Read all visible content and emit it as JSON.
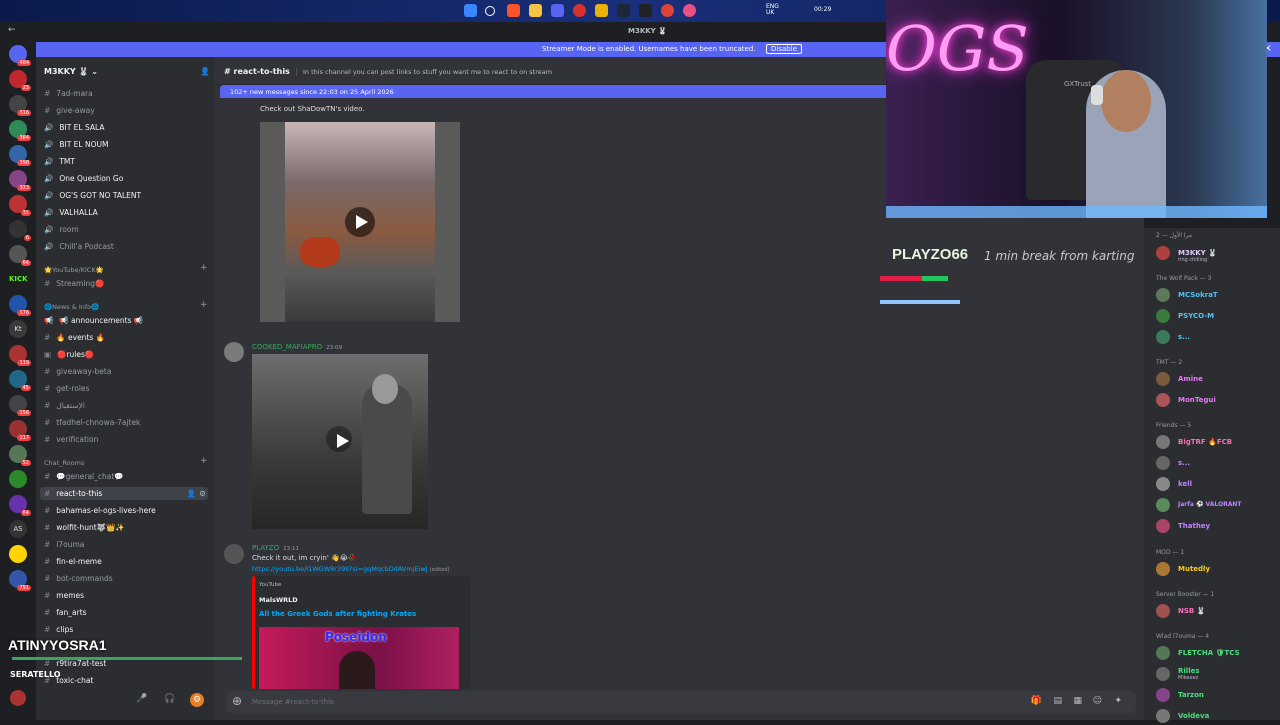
{
  "taskbar": {
    "tray_lang": "ENG",
    "tray_region": "UK",
    "time": "00:29"
  },
  "window": {
    "title": "M3KKY 🐰"
  },
  "streamer_banner": {
    "message": "Streamer Mode is enabled. Usernames have been truncated.",
    "disable_label": "Disable"
  },
  "server_badges": [
    "484",
    "23",
    "316",
    "384",
    "398",
    "323",
    "31",
    "6",
    "64",
    "176",
    "119",
    "45",
    "156",
    "117",
    "52",
    "64",
    "791"
  ],
  "sidebar": {
    "guild_name": "M3KKY 🐰",
    "channels_top": [
      "7ad-mara",
      "give-away",
      "BIT EL SALA",
      "BIT EL NOUM",
      "TMT",
      "One Question Go",
      "OG'S GOT NO TALENT",
      "VALHALLA",
      "room",
      "Chill'a Podcast"
    ],
    "cat_youtube": "🌟YouTube/KICK🌟",
    "streaming": "Streaming🔴",
    "cat_news": "🌐News & Info🌐",
    "news_channels": [
      "📢 announcements 📢",
      "🔥 events 🔥",
      "🔴rules🔴",
      "giveaway-beta",
      "get-roles",
      "الإستقبال",
      "tfadhel-chnowa-7ajtek",
      "verification"
    ],
    "cat_chat": "Chat_Rooms",
    "chat_channels": [
      "💬general_chat💬",
      "react-to-this",
      "bahamas-el-ogs-lives-here",
      "wolfit-hunt🐺👑✨",
      "l7ouma",
      "fin-el-meme",
      "bot-commands",
      "memes",
      "fan_arts",
      "clips",
      "r9tira7at-test",
      "toxic-chat"
    ]
  },
  "channel_header": {
    "name": "react-to-this",
    "topic": "In this channel you can post links to stuff you want me to react to on stream"
  },
  "new_messages_bar": "102+ new messages since 22:03 on 25 April 2026",
  "messages": {
    "shared_text": "Check out ShaDowTN's video.",
    "m2_author": "COOKED_MAFIAPRO",
    "m2_time": "23:09",
    "m3_author": "PLAYZO",
    "m3_time": "23:11",
    "m3_text": "Check it out, im cryin' 👋😭🥀",
    "m3_link": "https://youtu.be/l1WGW8r39lI?si=gqMqcbDdAVmjEiwJ",
    "m3_edited": "(edited)",
    "embed_provider": "YouTube",
    "embed_author": "MalsWRLD",
    "embed_title": "All the Greek Gods after fighting Kratos",
    "embed_thumb_text": "Poseidon"
  },
  "composer": {
    "placeholder": "Message #react-to-this"
  },
  "members": {
    "cat1": "2 — مرا الأول",
    "m1": "M3KKY 🐰",
    "m1_sub": "ring chilling",
    "cat2": "The Wolf Pack — 3",
    "wolf": [
      "MCSokraT",
      "PSYCO-M",
      "s..."
    ],
    "cat3": "TMT — 2",
    "tmt": [
      "Amine",
      "MonTegui"
    ],
    "cat4": "Friends — 5",
    "friends": [
      "BigTRF 🔥FCB",
      "s...",
      "kell",
      "Jarfa ⚽ VALORANT",
      "Thathey"
    ],
    "cat5": "MOD — 1",
    "mod": [
      "Mutedly"
    ],
    "cat6": "Server Booster — 1",
    "booster": [
      "NSB 🐰"
    ],
    "cat7": "Wlad l7ouma — 4",
    "wlad": [
      "FLETCHA 🛡TCS",
      "Rilles",
      "Tarzon",
      "Voldeva"
    ],
    "wlad_sub": "Mikeeez"
  },
  "overlay": {
    "name": "PLAYZO66",
    "note": "1 min break from karting",
    "bottom_name": "ATINYYOSRA1",
    "bottom_sub": "SERATELLO",
    "neon_text": "OGS",
    "chair_brand": "GXTrust",
    "hp_fraction": 0.45,
    "hp_fill_fraction": 0.73
  },
  "colors": {
    "accent": "#5865f2",
    "online": "#23a55a",
    "dnd": "#f23f43"
  }
}
